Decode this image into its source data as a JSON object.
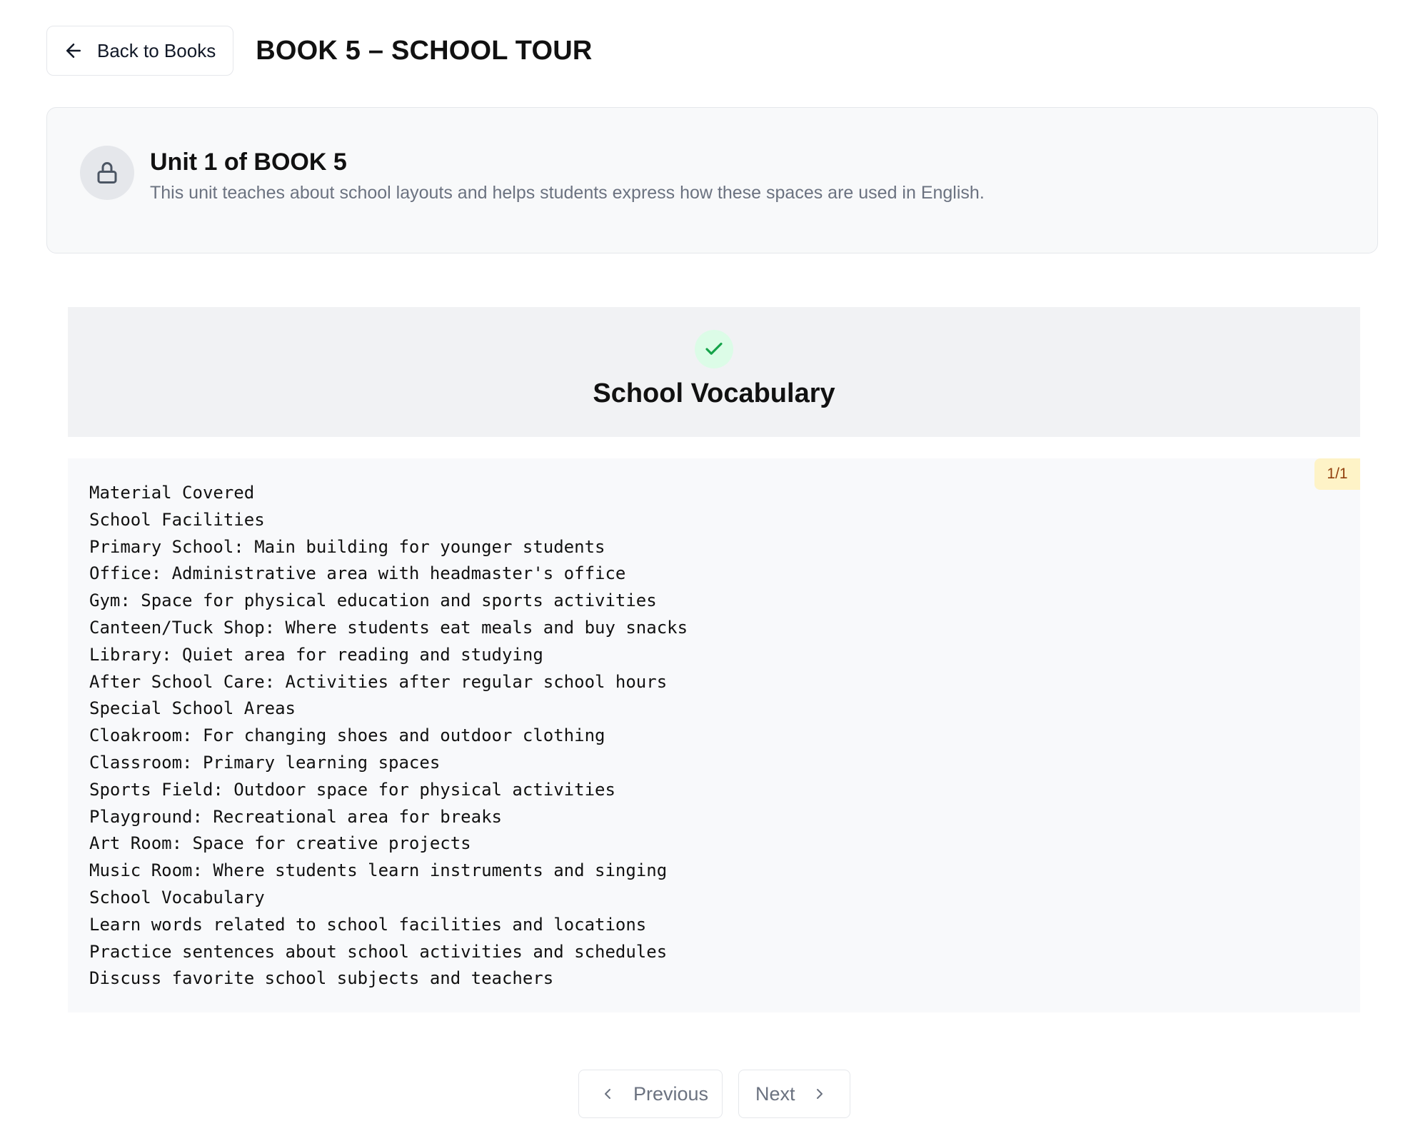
{
  "header": {
    "back_label": "Back to Books",
    "title": "BOOK 5 – SCHOOL TOUR"
  },
  "unit": {
    "title": "Unit 1 of BOOK 5",
    "description": "This unit teaches about school layouts and helps students express how these spaces are used in English.",
    "icon": "lock-icon"
  },
  "lesson": {
    "title": "School Vocabulary",
    "status_icon": "check-icon",
    "page_indicator": "1/1",
    "lines": [
      "Material Covered",
      "School Facilities",
      "Primary School: Main building for younger students",
      "Office: Administrative area with headmaster's office",
      "Gym: Space for physical education and sports activities",
      "Canteen/Tuck Shop: Where students eat meals and buy snacks",
      "Library: Quiet area for reading and studying",
      "After School Care: Activities after regular school hours",
      "Special School Areas",
      "Cloakroom: For changing shoes and outdoor clothing",
      "Classroom: Primary learning spaces",
      "Sports Field: Outdoor space for physical activities",
      "Playground: Recreational area for breaks",
      "Art Room: Space for creative projects",
      "Music Room: Where students learn instruments and singing",
      "School Vocabulary",
      "Learn words related to school facilities and locations",
      "Practice sentences about school activities and schedules",
      "Discuss favorite school subjects and teachers"
    ]
  },
  "pagination": {
    "previous_label": "Previous",
    "next_label": "Next"
  },
  "colors": {
    "success": "#16a34a",
    "badge_bg": "#fef3c7",
    "muted_text": "#6b7280"
  }
}
